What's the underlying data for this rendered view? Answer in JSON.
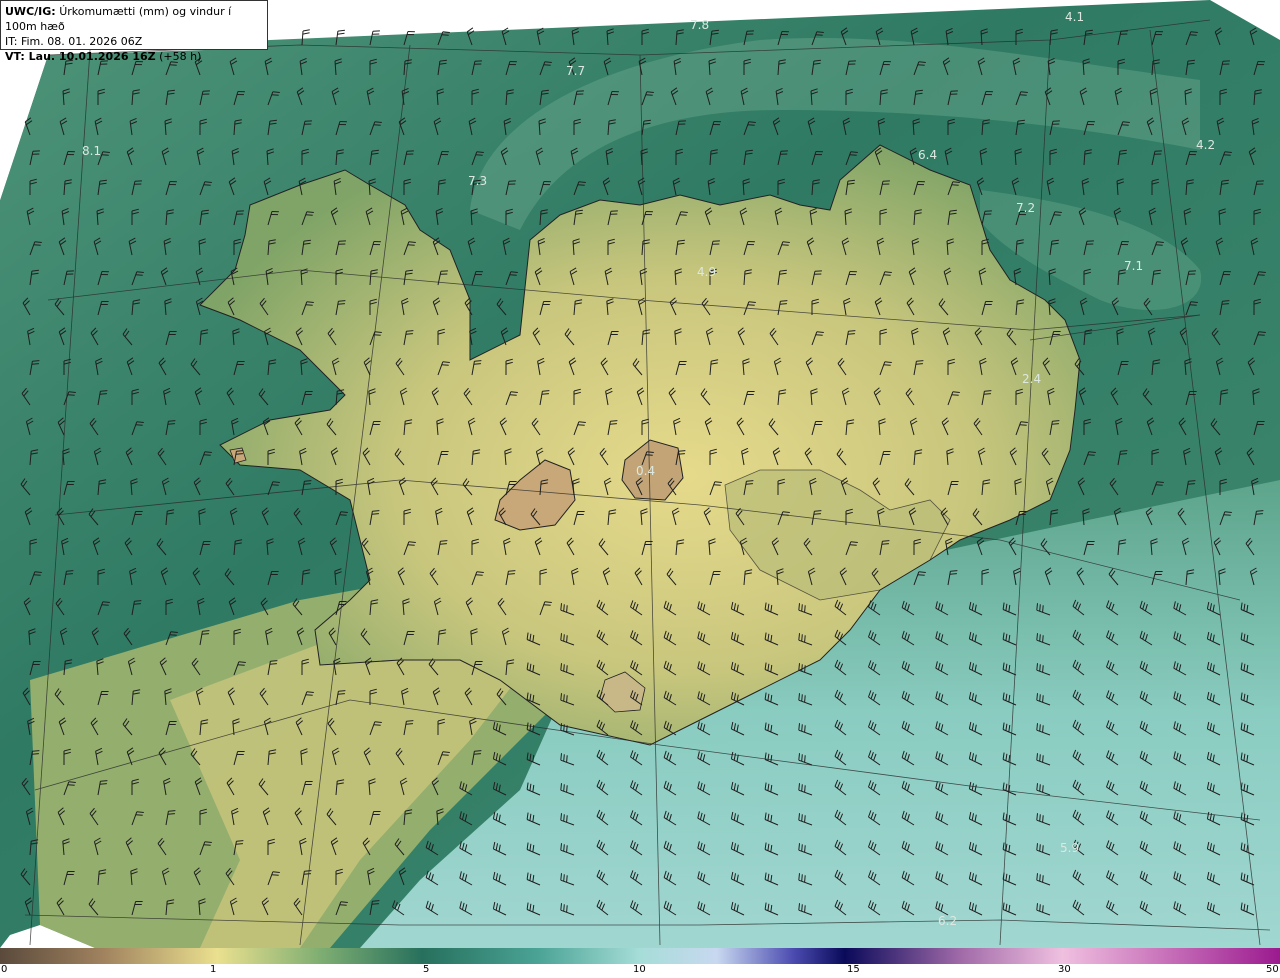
{
  "header": {
    "product": "UWC/IG:",
    "title": "Úrkomumætti (mm) og vindur í 100m hæð",
    "issue_time": "IT: Fim. 08. 01. 2026 06Z",
    "valid_prefix": "VT: Lau. 10.01.2026 16Z",
    "valid_suffix": "(+58 h)"
  },
  "map_labels": [
    {
      "id": "l1",
      "text": "7.8"
    },
    {
      "id": "l2",
      "text": "4.1"
    },
    {
      "id": "l3",
      "text": "7.7"
    },
    {
      "id": "l4",
      "text": "8.1"
    },
    {
      "id": "l5",
      "text": "7.3"
    },
    {
      "id": "l6",
      "text": "6.4"
    },
    {
      "id": "l7",
      "text": "4.2"
    },
    {
      "id": "l8",
      "text": "7.2"
    },
    {
      "id": "l9",
      "text": "7.1"
    },
    {
      "id": "l10",
      "text": "4.9"
    },
    {
      "id": "l11",
      "text": "2.4"
    },
    {
      "id": "l12",
      "text": "0.4"
    },
    {
      "id": "l13",
      "text": "5.9"
    },
    {
      "id": "l14",
      "text": "6.2"
    }
  ],
  "colorbar": {
    "ticks": [
      "0",
      "1",
      "5",
      "10",
      "15",
      "30",
      "50"
    ]
  },
  "colors": {
    "ocean_dark": "#2f7a63",
    "ocean_mid": "#4a8f72",
    "land_low": "#8fae6a",
    "land_mid": "#c4c57a",
    "land_high": "#e3d889",
    "peak": "#b89a6a",
    "south_wet": "#8dd1c6",
    "south_wetter": "#a9dcd9",
    "outside": "#ffffff"
  }
}
